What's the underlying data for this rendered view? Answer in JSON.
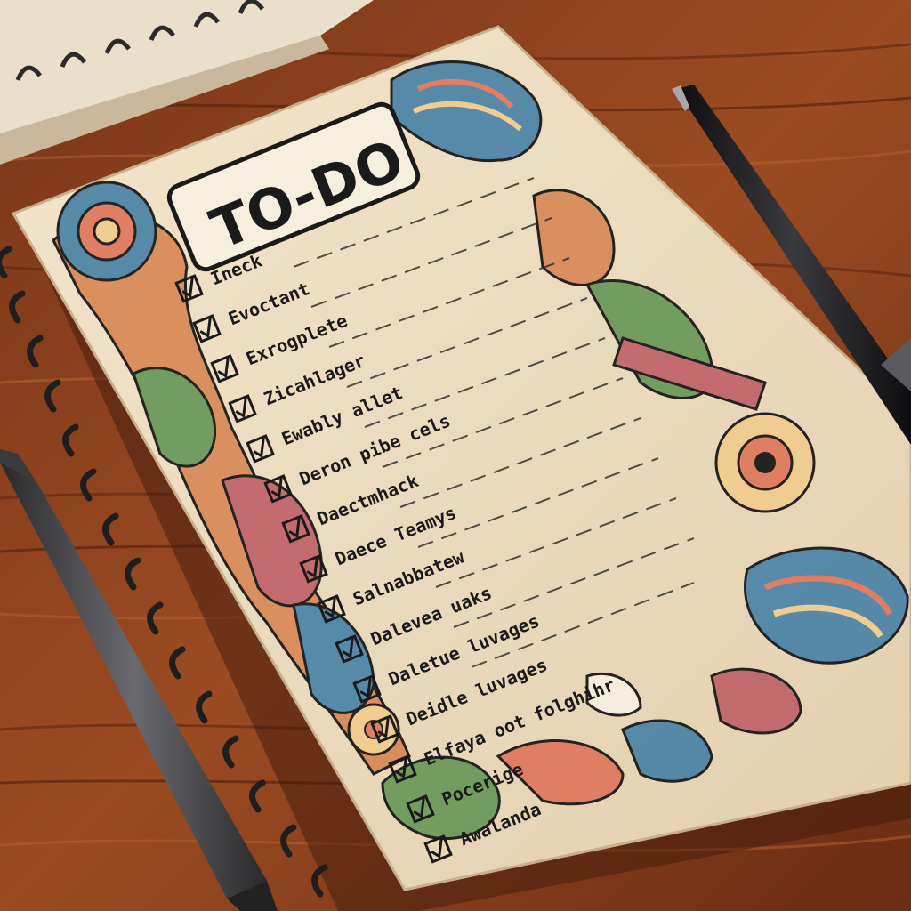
{
  "notebook": {
    "title": "TO-DO",
    "items": [
      {
        "text": "Ineck",
        "checked": true
      },
      {
        "text": "Evoctant",
        "checked": true
      },
      {
        "text": "Exrogplete",
        "checked": true
      },
      {
        "text": "Zicahlager",
        "checked": true
      },
      {
        "text": "Ewably allet",
        "checked": true
      },
      {
        "text": "Deron pibe cels",
        "checked": true
      },
      {
        "text": "Daectmhack",
        "checked": true
      },
      {
        "text": "Daece Teamys",
        "checked": true
      },
      {
        "text": "Salnabbatew",
        "checked": true
      },
      {
        "text": "Dalevea uaks",
        "checked": true
      },
      {
        "text": "Daletue luvages",
        "checked": true
      },
      {
        "text": "Deidle luvages",
        "checked": true
      },
      {
        "text": "Elfaya oot folghihr",
        "checked": true
      },
      {
        "text": "Pocerige",
        "checked": true
      },
      {
        "text": "Awalanda",
        "checked": true
      }
    ]
  },
  "colors": {
    "wood_dark": "#5a250f",
    "wood_mid": "#8a3f1c",
    "wood_light": "#a8562a",
    "paper": "#efe0c4",
    "ink": "#1a1a1a",
    "pen_body": "#1c1c1e",
    "pen_gray": "#4a4a4d"
  }
}
